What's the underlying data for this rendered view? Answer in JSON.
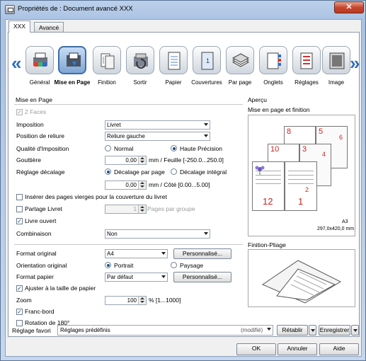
{
  "window": {
    "title": "Propriétés de : Document avancé XXX",
    "close_label": "✕"
  },
  "tabs": [
    {
      "label": "XXX"
    },
    {
      "label": "Avancé"
    }
  ],
  "ribbon": {
    "items": [
      {
        "label": "Général",
        "icon": "printer-color-icon"
      },
      {
        "label": "Mise en Page",
        "icon": "layout-icon"
      },
      {
        "label": "Finition",
        "icon": "finishing-icon"
      },
      {
        "label": "Sortir",
        "icon": "output-icon"
      },
      {
        "label": "Papier",
        "icon": "paper-icon"
      },
      {
        "label": "Couvertures",
        "icon": "covers-icon"
      },
      {
        "label": "Par page",
        "icon": "per-page-icon"
      },
      {
        "label": "Onglets",
        "icon": "tabs-icon"
      },
      {
        "label": "Réglages",
        "icon": "settings-icon"
      },
      {
        "label": "Image",
        "icon": "image-icon"
      }
    ],
    "left_arrow": "«",
    "right_arrow": "»"
  },
  "layout": {
    "group_title": "Mise en Page",
    "two_sided": "2 Faces",
    "imposition": {
      "label": "Imposition",
      "value": "Livret"
    },
    "binding": {
      "label": "Position de reliure",
      "value": "Reliure gauche"
    },
    "quality": {
      "label": "Qualité d'Imposition",
      "opt1": "Normal",
      "opt2": "Haute Précision"
    },
    "gutter": {
      "label": "Gouttière",
      "value": "0,00",
      "unit": "mm / Feuille [-250.0...250.0]"
    },
    "shift": {
      "label": "Réglage décalage",
      "opt1": "Décalage par page",
      "opt2": "Décalage intégral",
      "value": "0,00",
      "unit": "mm / Côté [0.00...5.00]"
    },
    "insert_blank": "Insérer des pages vierges pour la couverture du livret",
    "split_booklet": {
      "label": "Partage Livret",
      "value": "1",
      "unit": "Pages par groupe"
    },
    "open_booklet": "Livre ouvert",
    "combination": {
      "label": "Combinaison",
      "value": "Non"
    }
  },
  "paper": {
    "original_format": {
      "label": "Format original",
      "value": "A4",
      "button": "Personnalisé..."
    },
    "orientation": {
      "label": "Orientation original",
      "opt1": "Portrait",
      "opt2": "Paysage"
    },
    "paper_format": {
      "label": "Format papier",
      "value": "Par défaut",
      "button": "Personnalisé..."
    },
    "fit": "Ajuster à la taille de papier",
    "zoom": {
      "label": "Zoom",
      "value": "100",
      "unit": "% [1...1000]"
    },
    "bleed": "Franc-bord",
    "rotate": "Rotation de 180°"
  },
  "preview": {
    "title": "Aperçu",
    "subtitle": "Mise en page et finition",
    "page_numbers": [
      "8",
      "5",
      "10",
      "3",
      "12",
      "1",
      "6",
      "4",
      "2"
    ],
    "paper_size": "A3",
    "paper_dims": "297,0x420,0 mm",
    "finishing_title": "Finition-Pliage"
  },
  "favorites": {
    "label": "Réglage favori",
    "value": "Réglages prédéfinis",
    "state": "(modifié)",
    "restore": "Rétablir",
    "save": "Enregistrer"
  },
  "buttons": {
    "ok": "OK",
    "cancel": "Annuler",
    "help": "Aide"
  }
}
